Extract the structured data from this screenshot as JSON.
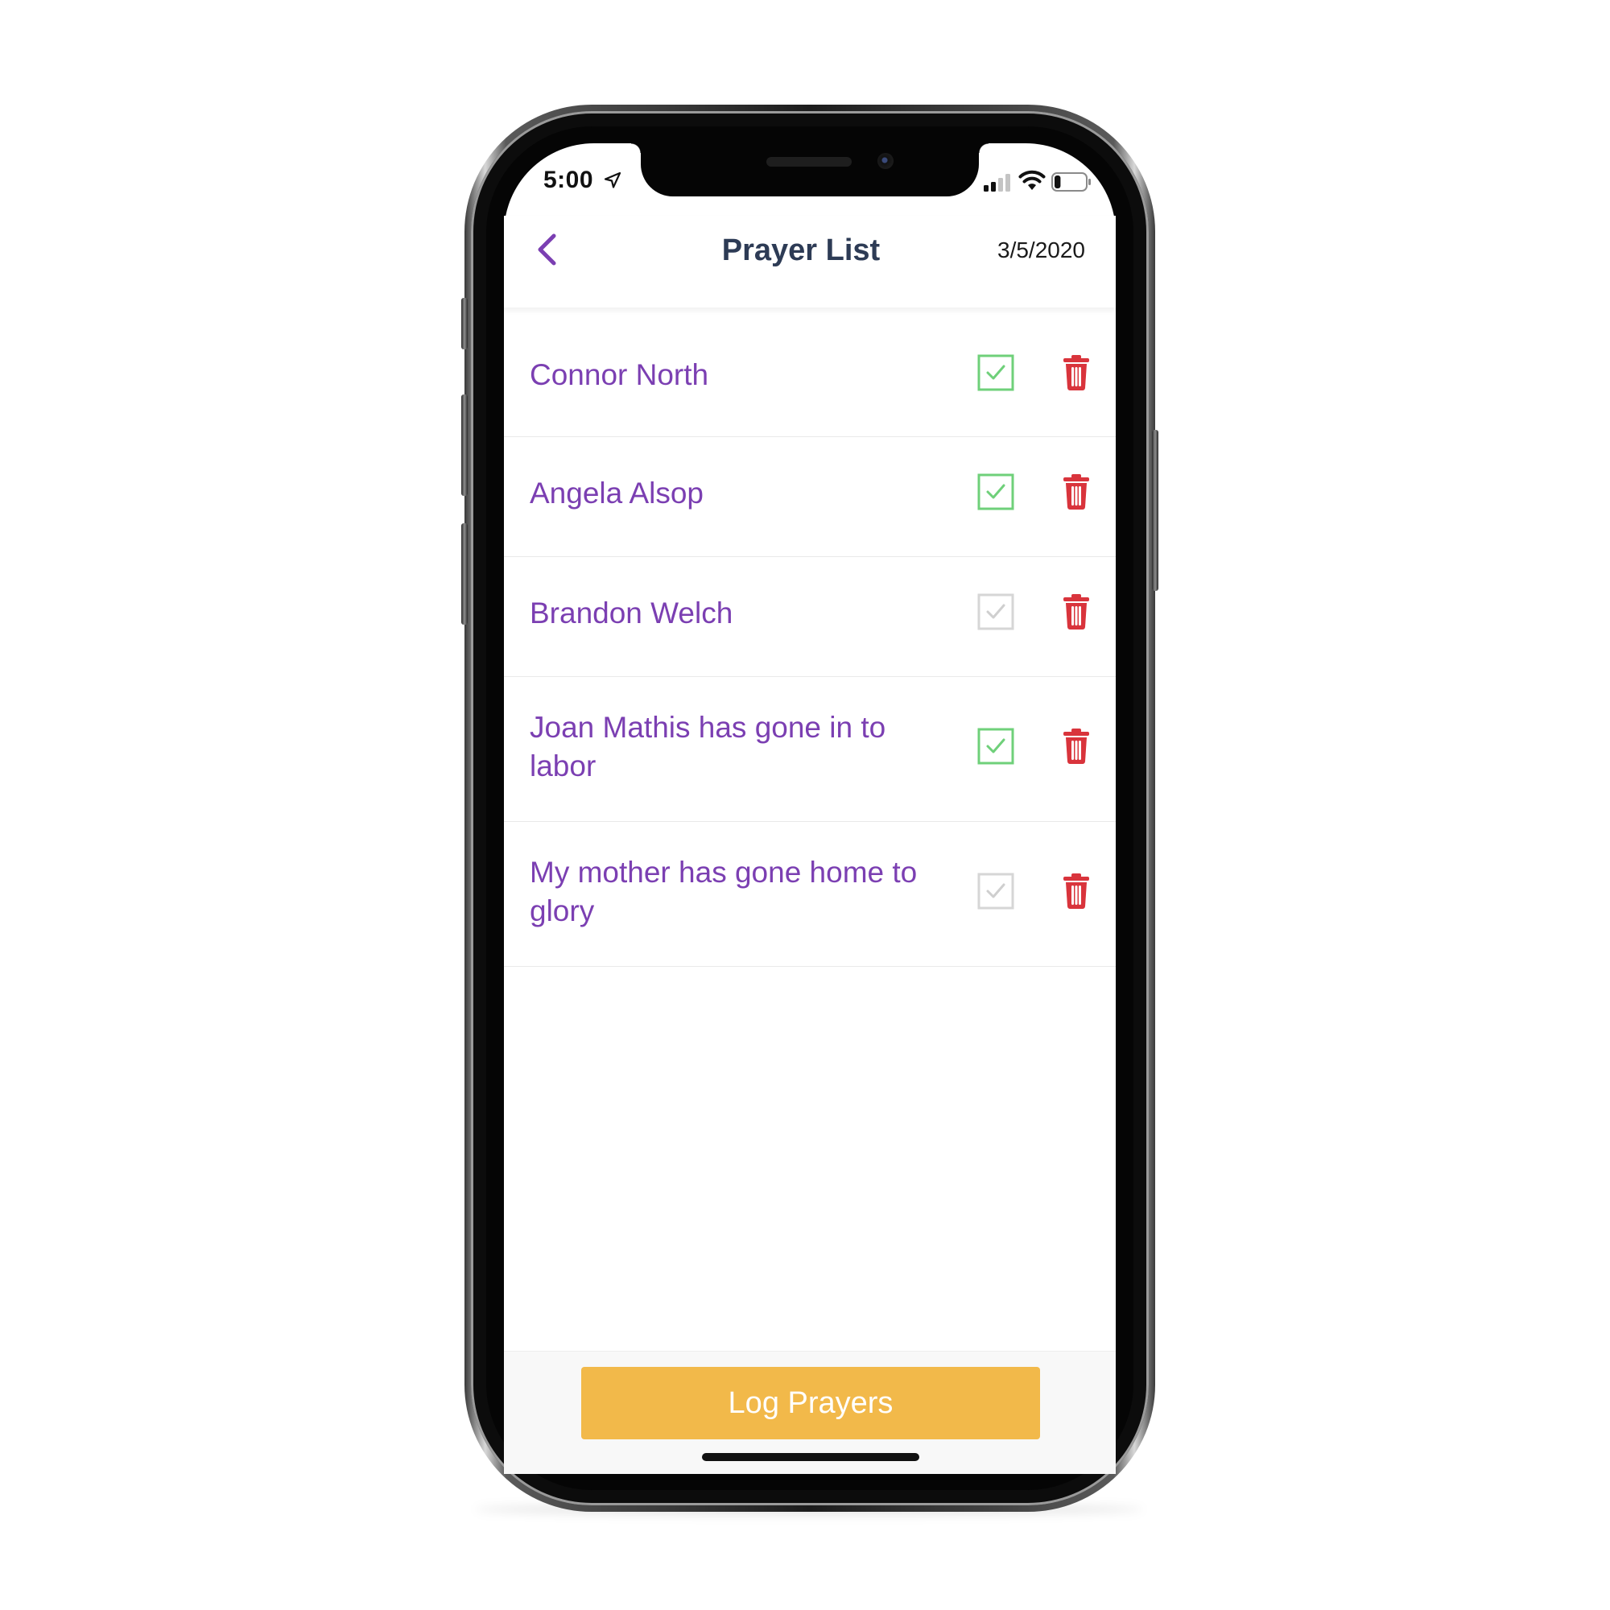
{
  "status_bar": {
    "time": "5:00",
    "location_icon": "location-arrow-icon",
    "signal_icon": "cellular-signal-icon",
    "wifi_icon": "wifi-icon",
    "battery_icon": "battery-icon",
    "signal_bars_active": 2,
    "signal_bars_total": 4,
    "battery_level": 0.2
  },
  "nav": {
    "back_icon": "chevron-left-icon",
    "title": "Prayer List",
    "date": "3/5/2020"
  },
  "list": {
    "items": [
      {
        "label": "Connor North",
        "checked": true
      },
      {
        "label": "Angela Alsop",
        "checked": true
      },
      {
        "label": "Brandon Welch",
        "checked": false
      },
      {
        "label": "Joan Mathis has gone in to labor",
        "checked": true
      },
      {
        "label": "My mother has gone home to glory",
        "checked": false
      }
    ],
    "check_icon": "checkbox-icon",
    "delete_icon": "trash-icon"
  },
  "footer": {
    "log_button_label": "Log Prayers"
  },
  "colors": {
    "accent_purple": "#7b3fb2",
    "title_navy": "#2d3b55",
    "check_green": "#6fd07a",
    "check_inactive": "#d6d6d6",
    "trash_red": "#d9343c",
    "button_yellow": "#f2b94a"
  }
}
